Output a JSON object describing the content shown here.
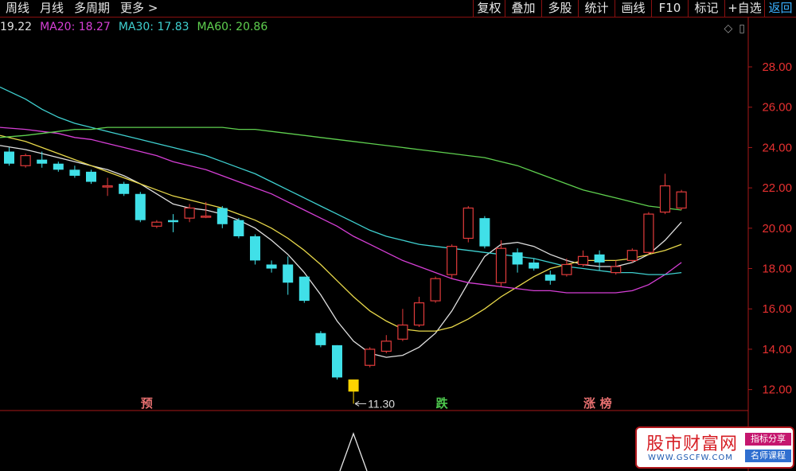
{
  "toolbar": {
    "left": [
      {
        "id": "week",
        "label": "周线"
      },
      {
        "id": "month",
        "label": "月线"
      },
      {
        "id": "multi_period",
        "label": "多周期"
      },
      {
        "id": "more",
        "label": "更多 >"
      }
    ],
    "right": [
      {
        "id": "restore",
        "label": "复权"
      },
      {
        "id": "overlay",
        "label": "叠加"
      },
      {
        "id": "multi_stock",
        "label": "多股"
      },
      {
        "id": "stats",
        "label": "统计"
      },
      {
        "id": "draw_line",
        "label": "画线"
      },
      {
        "id": "f10",
        "label": "F10"
      },
      {
        "id": "mark",
        "label": "标记"
      },
      {
        "id": "add_watch",
        "label": "+自选"
      },
      {
        "id": "back",
        "label": "返回"
      }
    ]
  },
  "legend": {
    "ma10_value": "19.22",
    "ma20_label": "MA20: 18.27",
    "ma30_label": "MA30: 17.83",
    "ma60_label": "MA60: 20.86"
  },
  "colors": {
    "up": "#e23b3b",
    "down": "#40e0e8",
    "ma10": "#e0e0e0",
    "ma20": "#d63fd6",
    "ma30": "#3fd0d0",
    "ma60": "#5fd04f",
    "ma5": "#e8d84a",
    "axis": "#a81818",
    "axis_text": "#e83030",
    "highlight": "#ffd400"
  },
  "chart_data": {
    "type": "candlestick",
    "y_ticks": [
      "12.00",
      "14.00",
      "16.00",
      "18.00",
      "20.00",
      "22.00",
      "24.00",
      "26.00",
      "28.00"
    ],
    "ylim": [
      11.0,
      29.5
    ],
    "low_annotation": "11.30",
    "candles": [
      {
        "o": 23.8,
        "c": 23.2,
        "h": 24.0,
        "l": 23.1
      },
      {
        "o": 23.1,
        "c": 23.6,
        "h": 23.7,
        "l": 23.0
      },
      {
        "o": 23.4,
        "c": 23.2,
        "h": 23.8,
        "l": 23.0
      },
      {
        "o": 23.2,
        "c": 22.9,
        "h": 23.3,
        "l": 22.8
      },
      {
        "o": 22.9,
        "c": 22.6,
        "h": 23.1,
        "l": 22.5
      },
      {
        "o": 22.8,
        "c": 22.3,
        "h": 22.9,
        "l": 22.2
      },
      {
        "o": 22.1,
        "c": 22.1,
        "h": 22.5,
        "l": 21.6
      },
      {
        "o": 22.2,
        "c": 21.7,
        "h": 22.3,
        "l": 21.6
      },
      {
        "o": 21.7,
        "c": 20.4,
        "h": 21.8,
        "l": 20.3
      },
      {
        "o": 20.1,
        "c": 20.3,
        "h": 20.4,
        "l": 20.0
      },
      {
        "o": 20.4,
        "c": 20.3,
        "h": 20.7,
        "l": 19.8
      },
      {
        "o": 20.5,
        "c": 21.0,
        "h": 21.2,
        "l": 20.3
      },
      {
        "o": 20.6,
        "c": 20.6,
        "h": 21.3,
        "l": 20.5
      },
      {
        "o": 21.0,
        "c": 20.2,
        "h": 21.1,
        "l": 20.0
      },
      {
        "o": 20.4,
        "c": 19.6,
        "h": 20.5,
        "l": 19.5
      },
      {
        "o": 19.6,
        "c": 18.4,
        "h": 19.7,
        "l": 18.2
      },
      {
        "o": 18.2,
        "c": 18.0,
        "h": 18.4,
        "l": 17.8
      },
      {
        "o": 18.2,
        "c": 17.3,
        "h": 18.6,
        "l": 16.7
      },
      {
        "o": 17.6,
        "c": 16.4,
        "h": 17.6,
        "l": 16.3
      },
      {
        "o": 14.8,
        "c": 14.2,
        "h": 14.9,
        "l": 14.1
      },
      {
        "o": 14.2,
        "c": 12.6,
        "h": 14.2,
        "l": 12.5
      },
      {
        "o": 12.5,
        "c": 11.9,
        "h": 12.5,
        "l": 11.3,
        "highlight": true
      },
      {
        "o": 13.2,
        "c": 14.0,
        "h": 14.1,
        "l": 13.1
      },
      {
        "o": 13.9,
        "c": 14.4,
        "h": 14.7,
        "l": 13.8
      },
      {
        "o": 14.5,
        "c": 15.2,
        "h": 16.0,
        "l": 14.4
      },
      {
        "o": 15.2,
        "c": 16.3,
        "h": 16.6,
        "l": 15.1
      },
      {
        "o": 16.4,
        "c": 17.5,
        "h": 17.6,
        "l": 16.3
      },
      {
        "o": 17.7,
        "c": 19.1,
        "h": 19.2,
        "l": 17.5
      },
      {
        "o": 19.5,
        "c": 21.0,
        "h": 21.1,
        "l": 19.3
      },
      {
        "o": 20.5,
        "c": 19.1,
        "h": 20.6,
        "l": 19.0
      },
      {
        "o": 17.3,
        "c": 19.0,
        "h": 19.4,
        "l": 17.1
      },
      {
        "o": 18.8,
        "c": 18.2,
        "h": 19.0,
        "l": 17.8
      },
      {
        "o": 18.3,
        "c": 18.0,
        "h": 18.5,
        "l": 17.9
      },
      {
        "o": 17.7,
        "c": 17.4,
        "h": 17.9,
        "l": 17.2
      },
      {
        "o": 17.7,
        "c": 18.2,
        "h": 18.5,
        "l": 17.6
      },
      {
        "o": 18.2,
        "c": 18.6,
        "h": 18.9,
        "l": 18.1
      },
      {
        "o": 18.7,
        "c": 18.3,
        "h": 18.9,
        "l": 17.9
      },
      {
        "o": 17.8,
        "c": 18.1,
        "h": 18.4,
        "l": 17.7
      },
      {
        "o": 18.4,
        "c": 18.9,
        "h": 19.0,
        "l": 18.3
      },
      {
        "o": 18.8,
        "c": 20.7,
        "h": 20.8,
        "l": 18.7
      },
      {
        "o": 20.8,
        "c": 22.1,
        "h": 22.7,
        "l": 20.7
      },
      {
        "o": 21.0,
        "c": 21.8,
        "h": 21.9,
        "l": 20.9
      }
    ],
    "ma_lines": {
      "ma10": [
        24.1,
        23.9,
        23.7,
        23.5,
        23.3,
        23.1,
        22.9,
        22.6,
        22.2,
        21.7,
        21.2,
        21.0,
        20.9,
        20.7,
        20.4,
        20.0,
        19.4,
        18.7,
        17.8,
        16.7,
        15.4,
        14.4,
        13.8,
        13.6,
        13.7,
        14.1,
        14.8,
        15.9,
        17.3,
        18.6,
        19.2,
        19.3,
        19.1,
        18.7,
        18.4,
        18.2,
        18.1,
        18.1,
        18.3,
        18.7,
        19.4,
        20.3
      ],
      "ma5": [
        24.6,
        24.3,
        24.0,
        23.7,
        23.4,
        23.1,
        22.8,
        22.5,
        22.2,
        21.9,
        21.6,
        21.4,
        21.2,
        21.0,
        20.7,
        20.4,
        20.0,
        19.5,
        18.9,
        18.2,
        17.4,
        16.6,
        15.9,
        15.4,
        15.0,
        14.9,
        14.9,
        15.1,
        15.5,
        16.0,
        16.6,
        17.1,
        17.6,
        18.0,
        18.2,
        18.4,
        18.4,
        18.4,
        18.5,
        18.7,
        18.9,
        19.2
      ],
      "ma20": [
        25.0,
        24.9,
        24.8,
        24.7,
        24.5,
        24.4,
        24.2,
        24.0,
        23.8,
        23.6,
        23.3,
        23.1,
        22.9,
        22.6,
        22.3,
        22.0,
        21.7,
        21.3,
        20.9,
        20.5,
        20.1,
        19.6,
        19.2,
        18.8,
        18.4,
        18.1,
        17.8,
        17.5,
        17.3,
        17.2,
        17.1,
        17.0,
        16.9,
        16.9,
        16.8,
        16.8,
        16.8,
        16.8,
        16.9,
        17.2,
        17.7,
        18.3
      ],
      "ma30": [
        27.0,
        26.4,
        25.9,
        25.5,
        25.2,
        25.0,
        24.8,
        24.6,
        24.4,
        24.2,
        24.0,
        23.8,
        23.6,
        23.3,
        23.0,
        22.7,
        22.3,
        21.9,
        21.5,
        21.1,
        20.7,
        20.3,
        19.9,
        19.6,
        19.4,
        19.2,
        19.1,
        19.0,
        18.9,
        18.8,
        18.7,
        18.6,
        18.5,
        18.3,
        18.1,
        18.0,
        17.9,
        17.8,
        17.8,
        17.7,
        17.7,
        17.8
      ],
      "ma60": [
        24.5,
        24.6,
        24.7,
        24.8,
        24.9,
        24.9,
        25.0,
        25.0,
        25.0,
        25.0,
        25.0,
        25.0,
        25.0,
        25.0,
        24.9,
        24.9,
        24.8,
        24.7,
        24.6,
        24.5,
        24.4,
        24.3,
        24.2,
        24.1,
        24.0,
        23.9,
        23.8,
        23.7,
        23.6,
        23.5,
        23.3,
        23.1,
        22.8,
        22.5,
        22.2,
        21.9,
        21.7,
        21.5,
        21.3,
        21.1,
        21.0,
        20.9
      ]
    },
    "markers": [
      {
        "text": "预",
        "candle": 8,
        "color": "#e87070"
      },
      {
        "text": "跌",
        "candle": 26,
        "color": "#4ec84e"
      },
      {
        "text": "涨",
        "candle": 35,
        "color": "#e87070"
      },
      {
        "text": "榜",
        "candle": 36,
        "color": "#e87070"
      }
    ]
  },
  "watermark": {
    "title": "股市财富网",
    "url": "WWW.GSCFW.COM",
    "tag1": "指标分享",
    "tag2": "名师课程"
  }
}
